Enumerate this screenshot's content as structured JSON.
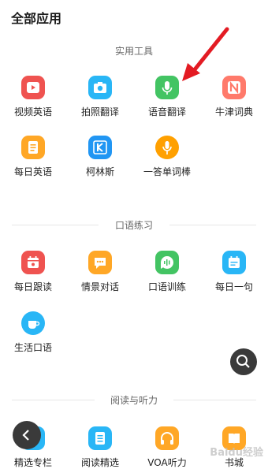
{
  "header": {
    "title": "全部应用"
  },
  "sections": [
    {
      "title": "实用工具",
      "apps": [
        {
          "label": "视频英语",
          "icon": "video-play-icon",
          "color": "#ef5350"
        },
        {
          "label": "拍照翻译",
          "icon": "camera-icon",
          "color": "#29b6f6"
        },
        {
          "label": "语音翻译",
          "icon": "microphone-icon",
          "color": "#43c463"
        },
        {
          "label": "牛津词典",
          "icon": "letter-n-icon",
          "color": "#ff7a6b"
        },
        {
          "label": "每日英语",
          "icon": "document-icon",
          "color": "#ffa726"
        },
        {
          "label": "柯林斯",
          "icon": "letter-k-icon",
          "color": "#2196f3"
        },
        {
          "label": "一答单词棒",
          "icon": "mic-badge-icon",
          "color": "#ffa000"
        }
      ]
    },
    {
      "title": "口语练习",
      "apps": [
        {
          "label": "每日跟读",
          "icon": "calendar-icon",
          "color": "#ef5350"
        },
        {
          "label": "情景对话",
          "icon": "chat-bubble-icon",
          "color": "#ffa726"
        },
        {
          "label": "口语训练",
          "icon": "sound-wave-icon",
          "color": "#43c463"
        },
        {
          "label": "每日一句",
          "icon": "calendar-list-icon",
          "color": "#29b6f6"
        },
        {
          "label": "生活口语",
          "icon": "coffee-cup-icon",
          "color": "#29b6f6"
        }
      ]
    },
    {
      "title": "阅读与听力",
      "apps": [
        {
          "label": "精选专栏",
          "icon": "column-icon",
          "color": "#29b6f6"
        },
        {
          "label": "阅读精选",
          "icon": "reading-icon",
          "color": "#29b6f6"
        },
        {
          "label": "VOA听力",
          "icon": "headphones-icon",
          "color": "#ffa726"
        },
        {
          "label": "书城",
          "icon": "book-icon",
          "color": "#ffa726"
        }
      ]
    }
  ],
  "floating": {
    "search_icon": "search-icon",
    "back_icon": "chevron-left-icon"
  },
  "watermark": "Baidu经验",
  "annotation": {
    "color": "#e31b23"
  }
}
